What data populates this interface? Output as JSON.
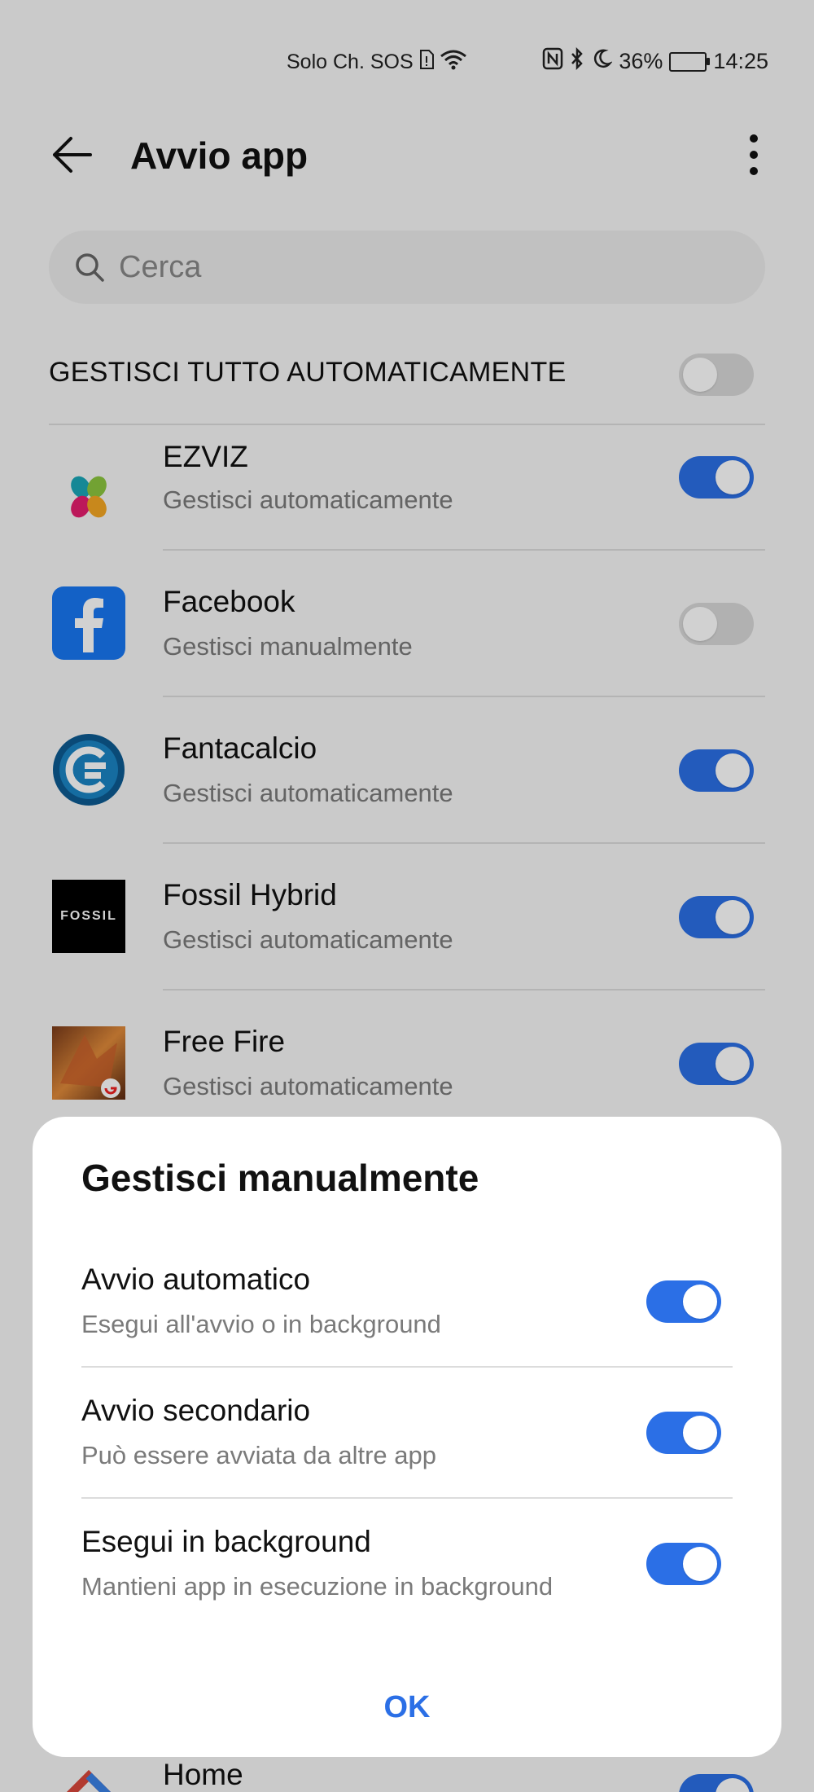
{
  "status_bar": {
    "carrier": "Solo Ch. SOS",
    "battery": "36%",
    "time": "14:25"
  },
  "header": {
    "title": "Avvio app"
  },
  "search": {
    "placeholder": "Cerca"
  },
  "manage_all": {
    "label": "GESTISCI TUTTO AUTOMATICAMENTE",
    "enabled": false
  },
  "apps": [
    {
      "name": "EZVIZ",
      "subtitle": "Gestisci automaticamente",
      "enabled": true,
      "icon": "ezviz-icon"
    },
    {
      "name": "Facebook",
      "subtitle": "Gestisci manualmente",
      "enabled": false,
      "icon": "facebook-icon"
    },
    {
      "name": "Fantacalcio",
      "subtitle": "Gestisci automaticamente",
      "enabled": true,
      "icon": "fantacalcio-icon"
    },
    {
      "name": "Fossil Hybrid",
      "subtitle": "Gestisci automaticamente",
      "enabled": true,
      "icon": "fossil-icon",
      "icon_text": "FOSSIL"
    },
    {
      "name": "Free Fire",
      "subtitle": "Gestisci automaticamente",
      "enabled": true,
      "icon": "free-fire-icon"
    },
    {
      "name": "Home",
      "subtitle": "",
      "enabled": true,
      "icon": "home-icon"
    }
  ],
  "dialog": {
    "title": "Gestisci manualmente",
    "options": [
      {
        "name": "Avvio automatico",
        "subtitle": "Esegui all'avvio o in background",
        "enabled": true
      },
      {
        "name": "Avvio secondario",
        "subtitle": "Può essere avviata da altre app",
        "enabled": true
      },
      {
        "name": "Esegui in background",
        "subtitle": "Mantieni app in esecuzione in background",
        "enabled": true
      }
    ],
    "ok_label": "OK"
  },
  "colors": {
    "accent": "#2b6fe6",
    "toggle_off": "#d8d8d8"
  }
}
